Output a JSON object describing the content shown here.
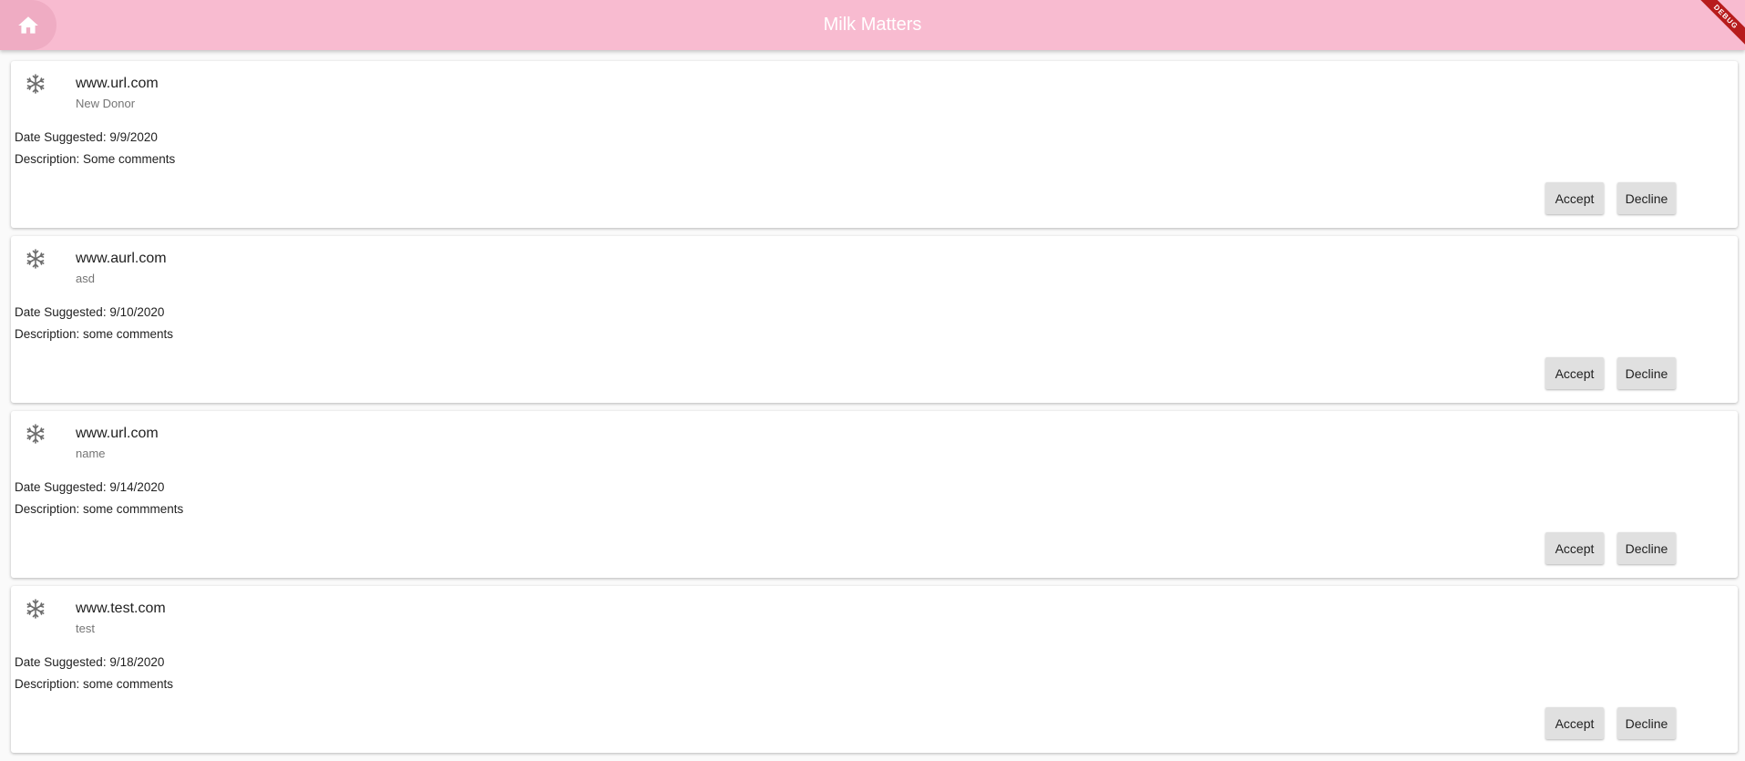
{
  "appbar": {
    "title": "Milk Matters",
    "home_icon": "home-icon",
    "color": "#f8bbd0"
  },
  "debug_banner": "DEBUG",
  "suggestions": [
    {
      "icon": "snowflake-icon",
      "site": "www.url.com",
      "name": "New Donor",
      "date_text": "Date Suggested: 9/9/2020",
      "description_text": "Description: Some comments",
      "accept_label": "Accept",
      "decline_label": "Decline"
    },
    {
      "icon": "snowflake-icon",
      "site": "www.aurl.com",
      "name": "asd",
      "date_text": "Date Suggested: 9/10/2020",
      "description_text": "Description: some comments",
      "accept_label": "Accept",
      "decline_label": "Decline"
    },
    {
      "icon": "snowflake-icon",
      "site": "www.url.com",
      "name": "name",
      "date_text": "Date Suggested: 9/14/2020",
      "description_text": "Description: some commments",
      "accept_label": "Accept",
      "decline_label": "Decline"
    },
    {
      "icon": "snowflake-icon",
      "site": "www.test.com",
      "name": "test",
      "date_text": "Date Suggested: 9/18/2020",
      "description_text": "Description: some comments",
      "accept_label": "Accept",
      "decline_label": "Decline"
    }
  ]
}
